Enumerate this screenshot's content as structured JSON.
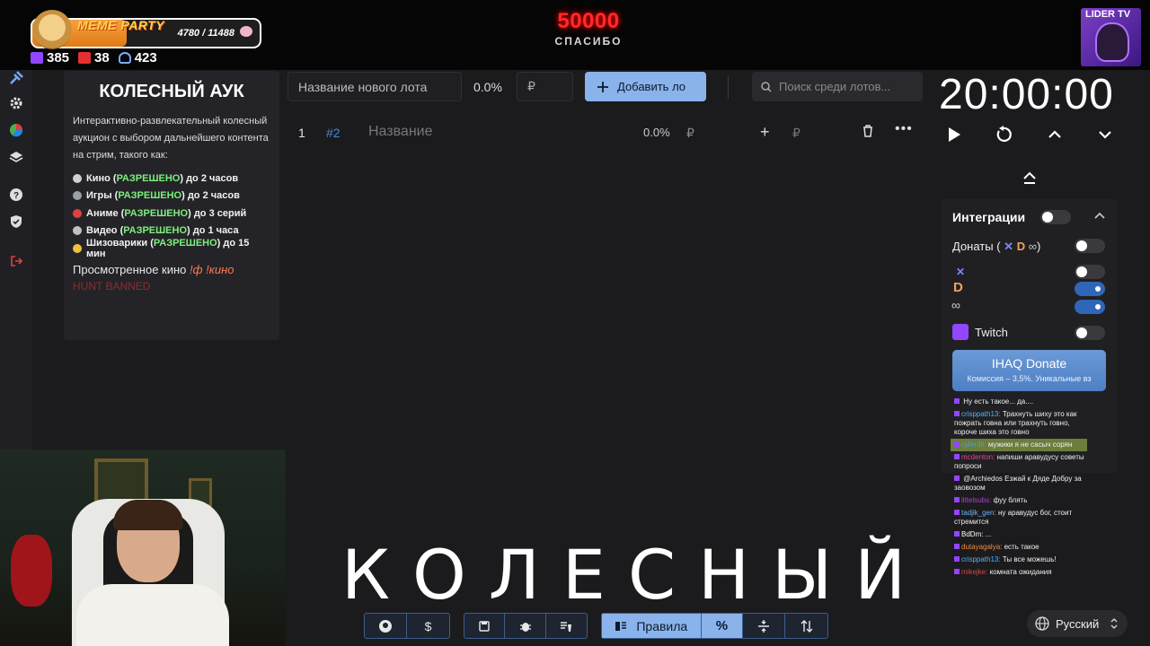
{
  "overlay": {
    "meme_title": "MEME PARTY",
    "meme_count": "4780 / 11488",
    "meme_progress": 0.416,
    "stats": {
      "twitch": "385",
      "live": "38",
      "viewers": "423"
    },
    "goal_value": "50000",
    "goal_label": "СПАСИБО",
    "channel_logo_text": "LIDER TV"
  },
  "nav": {
    "items": [
      "hammer-icon",
      "gear-icon",
      "pie-chart-icon",
      "layers-icon",
      "help-icon",
      "shield-icon",
      "logout-icon"
    ]
  },
  "description": {
    "title": "КОЛЕСНЫЙ АУК",
    "text": "Интерактивно-развлекательный колесный аукцион с выбором дальнейшего контента на стрим, такого как:",
    "items": [
      {
        "name": "Кино (",
        "status": "РАЗРЕШЕНО",
        "rest": ") до 2 часов",
        "color": "#d0d0d0"
      },
      {
        "name": "Игры (",
        "status": "РАЗРЕШЕНО",
        "rest": ") до 2 часов",
        "color": "#9aa0a8"
      },
      {
        "name": "Аниме (",
        "status": "РАЗРЕШЕНО",
        "rest": ") до 3 серий",
        "color": "#e04040"
      },
      {
        "name": "Видео (",
        "status": "РАЗРЕШЕНО",
        "rest": ") до 1 часа",
        "color": "#c0c0c0"
      },
      {
        "name": "Шизоварики (",
        "status": "РАЗРЕШЕНО",
        "rest": ") до 15 мин",
        "color": "#f0c040"
      }
    ],
    "watched_label": "Просмотренное кино",
    "watched_cmd": "!ф !кино",
    "banned": "HUNT BANNED"
  },
  "toolbar": {
    "lot_name_placeholder": "Название нового лота",
    "percent": "0.0%",
    "currency": "₽",
    "add_label": "Добавить ло",
    "search_placeholder": "Поиск среди лотов..."
  },
  "lot": {
    "index": "1",
    "id": "#2",
    "title": "Название",
    "percent": "0.0%",
    "currency": "₽",
    "currency2": "₽"
  },
  "timer": {
    "value": "20:00:00"
  },
  "integrations": {
    "title": "Интеграции",
    "donations_label": "Донаты (",
    "donations_close": ")",
    "twitch_label": "Twitch",
    "donate_name": "IHAQ Donate",
    "donate_sub": "Комиссия – 3,5%. Уникальные вз"
  },
  "chat": [
    {
      "user": "",
      "text": "Ну есть такое... да....",
      "ucolor": "#8fb3ff"
    },
    {
      "user": "crisppath13:",
      "text": "Трахнуть шиху это как пожрать говна или трахнуть говно, короче шиха это говно",
      "ucolor": "#4fb3ff"
    },
    {
      "user": "cj4er4ll:",
      "text": "мужики я не сасыч сорян",
      "ucolor": "#3aa0ff",
      "highlight": true
    },
    {
      "user": "mcdenton:",
      "text": "напиши аравудусу советы попроси",
      "ucolor": "#e04a8c"
    },
    {
      "user": "",
      "text": "@Archiedos Езжай к Дяде Добру за заовозом",
      "ucolor": "#5b5bff"
    },
    {
      "user": "littelsubs:",
      "text": "фуу блять",
      "ucolor": "#b040d0"
    },
    {
      "user": "tadjik_gen:",
      "text": "ну аравудус бог, стоит стремится",
      "ucolor": "#6ab0ff"
    },
    {
      "user": "BdDm:",
      "text": "...",
      "ucolor": "#ffffff"
    },
    {
      "user": "dutayagalya:",
      "text": "есть такое",
      "ucolor": "#f08c40"
    },
    {
      "user": "crisppath13:",
      "text": "Ты все можешь!",
      "ucolor": "#4fb3ff"
    },
    {
      "user": "mikejke:",
      "text": "комната ожидания",
      "ucolor": "#e04040"
    }
  ],
  "caption": "КОЛЕСНЫЙ",
  "bottom": {
    "rules_label": "Правила",
    "percent_symbol": "%",
    "language": "Русский"
  }
}
